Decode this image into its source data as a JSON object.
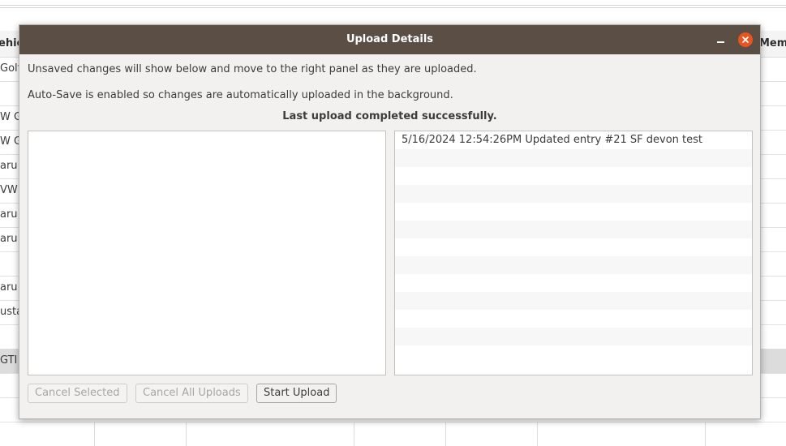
{
  "background_table": {
    "headers": {
      "left": "ehic",
      "right": "Mem"
    },
    "rows": [
      {
        "cell": "Golf"
      },
      {
        "cell": ""
      },
      {
        "cell": "W GT"
      },
      {
        "cell": "W Go"
      },
      {
        "cell": "aru"
      },
      {
        "cell": "VW J"
      },
      {
        "cell": "aru"
      },
      {
        "cell": "aru"
      },
      {
        "cell": ""
      },
      {
        "cell": "aru"
      },
      {
        "cell": "usta"
      },
      {
        "cell": ""
      },
      {
        "cell": "GTI",
        "selected": true
      },
      {
        "cell": ""
      },
      {
        "cell": ""
      }
    ]
  },
  "dialog": {
    "title": "Upload Details",
    "message1": "Unsaved changes will show below and move to the right panel as they are uploaded.",
    "message2": "Auto-Save is enabled so changes are automatically uploaded in the background.",
    "status": "Last upload completed successfully.",
    "pending_items": [],
    "uploaded_items": [
      "5/16/2024 12:54:26PM Updated entry #21 SF devon test",
      "",
      "",
      "",
      "",
      "",
      "",
      "",
      "",
      "",
      "",
      "",
      ""
    ],
    "buttons": {
      "cancel_selected": "Cancel Selected",
      "cancel_all": "Cancel All Uploads",
      "start_upload": "Start Upload"
    },
    "icons": {
      "minimize": "minimize-icon",
      "close": "close-icon"
    },
    "colors": {
      "titlebar": "#5b4f45",
      "close": "#e95420"
    }
  }
}
